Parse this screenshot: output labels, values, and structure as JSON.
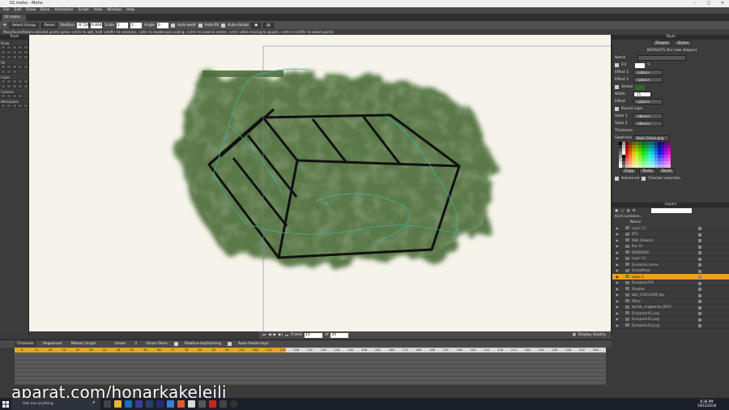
{
  "window": {
    "title": "02.moho - Moho"
  },
  "menu": [
    "File",
    "Edit",
    "Draw",
    "Bone",
    "Animation",
    "Script",
    "View",
    "Window",
    "Help"
  ],
  "document_tab": "02.moho",
  "options": {
    "select_group": "Select Group",
    "reset": "Reset",
    "position_label": "Position",
    "x_value": "-0.7268",
    "y_value": "0.8445",
    "scale_label": "Scale",
    "scale_x": "1",
    "scale_y": "1",
    "angle_label": "Angle",
    "angle_value": "0",
    "auto_weld": "Auto-weld",
    "auto_fill": "Auto-fill",
    "auto_stroke": "Auto-stroke"
  },
  "hint": "Move/Scale/Rotate selected points (press <ctrl> to add, hold <shift> to constrain, <alt> to double-axis scaling, <ctrl> to scale to center, <ctrl> while moving to squash, <ctrl>+<shift> to select points)",
  "tools": {
    "title": "Tools",
    "sections": [
      "Draw",
      "Fill",
      "Layer",
      "Camera",
      "Workspace"
    ]
  },
  "canvas_bar": {
    "frame_label": "Frame",
    "frame_value": "10",
    "of_label": "of",
    "total": "20",
    "display_quality": "Display Quality"
  },
  "style_panel": {
    "title": "Style",
    "shapes_label": "Shapes",
    "styles_label": "Styles",
    "defaults_label": "DEFAULTS (for new shapes)",
    "name_label": "Name",
    "fill_label": "Fill",
    "effect1_label": "Effect 1",
    "effect1_value": "<plain>",
    "effect2_label": "Effect 2",
    "effect2_value": "<plain>",
    "stroke_label": "Stroke",
    "width_label": "Width",
    "width_value": "15",
    "effect_label": "Effect",
    "effect_value": "<plain>",
    "round_caps": "Round caps",
    "style1_label": "Style 1",
    "style1_value": "<None>",
    "style2_label": "Style 2",
    "style2_value": "<None>",
    "thickness_label": "Thickness",
    "swatches_label": "Swatches",
    "swatches_value": "Basic Colors.png",
    "copy": "Copy",
    "paste": "Paste",
    "reset": "Reset",
    "advanced": "Advanced",
    "checker_selection": "Checker selection"
  },
  "layers_panel": {
    "title": "Layers",
    "filter_label": "Kind contains...",
    "name_header": "Name",
    "layers": [
      {
        "name": "Layer 11",
        "selected": false
      },
      {
        "name": "BTS",
        "selected": false
      },
      {
        "name": "Wait_Blowsm",
        "selected": false
      },
      {
        "name": "Box Fk",
        "selected": false
      },
      {
        "name": "BOXBOOM",
        "selected": false
      },
      {
        "name": "Layer 13",
        "selected": false
      },
      {
        "name": "Dumpster.scene",
        "selected": false
      },
      {
        "name": "DumpMash",
        "selected": false
      },
      {
        "name": "Layer 2",
        "selected": true
      },
      {
        "name": "DumpsterFKS",
        "selected": false
      },
      {
        "name": "Shadow",
        "selected": false
      },
      {
        "name": "bg3_1920x1080.jpg",
        "selected": false
      },
      {
        "name": "Wires",
        "selected": false
      },
      {
        "name": "bpnkb_crugbwhite_BSTY...",
        "selected": false
      },
      {
        "name": "Dumpster01.png",
        "selected": false
      },
      {
        "name": "Dumpster02.png",
        "selected": false
      },
      {
        "name": "Dumpster03.png",
        "selected": false
      }
    ]
  },
  "timeline": {
    "tabs": [
      "Channels",
      "Sequencer",
      "Motion Graph"
    ],
    "interp": "Linear",
    "interp_num": "2",
    "onion": "Onion Skins",
    "relative_keyframing": "Relative keyframing",
    "auto_freeze": "Auto-freeze keys",
    "ruler_ticks": [
      "6",
      "12",
      "18",
      "24",
      "30",
      "36",
      "42",
      "48",
      "54",
      "60",
      "66",
      "72",
      "78",
      "84",
      "90",
      "96",
      "102",
      "108",
      "114",
      "120",
      "126",
      "132",
      "138",
      "144",
      "150",
      "156",
      "162",
      "168",
      "174",
      "180",
      "186",
      "192",
      "198",
      "204",
      "210",
      "216",
      "222",
      "228",
      "234",
      "240",
      "246",
      "252",
      "258"
    ]
  },
  "watermark": "aparat.com/honarkakeleili",
  "taskbar": {
    "search_placeholder": "Ask me anything",
    "time": "8:38 PM",
    "date": "10/12/2018"
  },
  "colors": {
    "selected_layer": "#e8a21c",
    "timeline_played": "#e6a81e",
    "paint_green": "#4e6e3a",
    "canvas": "#f5f3ea"
  }
}
